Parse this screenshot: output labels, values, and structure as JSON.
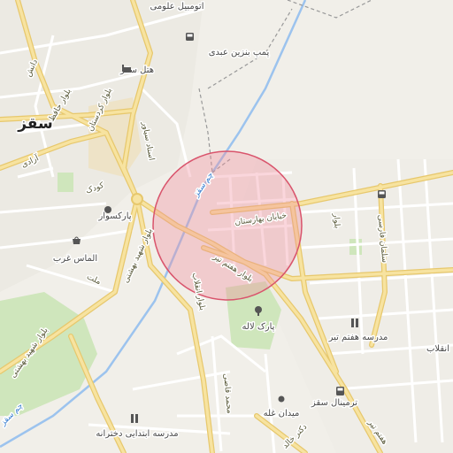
{
  "map": {
    "city": "سقز",
    "highlight": {
      "fill": "#f08a9a",
      "stroke": "#d9546c"
    },
    "labels": {
      "automobile": "اتومبیل علومی",
      "gas_station": "پمپ بنزین عبدی",
      "hotel": "هتل سقز",
      "boulevard_kurdistan": "بلوار کردستان",
      "boulevard_hafez": "بلوار حافظ",
      "ostad_seyavar": "استاد سیاور",
      "azadi": "آزادی",
      "koodak": "کودک",
      "parksvar": "پارکسوار",
      "almas_gharb": "الماس غرب",
      "mellat": "ملت",
      "shahid_beheshti": "بلوار شهید بهشتی",
      "shahid_beheshti_2": "بلوار شهید بهشتی",
      "khiaban_baharestan": "خیابان بهارستان",
      "boulevard_haftom_tir": "بلوار هفتم تیر",
      "boulevard_enghelab": "بلوار انقلاب",
      "boulevard_small": "بلوار",
      "salman_farsi": "سلمان فارسی",
      "enghelab": "انقلاب",
      "park_laleh": "پارک لاله",
      "madreseh_haftom_tir": "مدرسه هفتم تیر",
      "mohammad_ghazi": "محمد قاضی",
      "meydan_ghaleh": "میدان غله",
      "terminal": "ترمینال سقز",
      "haftom_tir": "هفتم تیر",
      "dr_khaled": "دکتر خالد",
      "madreseh_ebtedaei": "مدرسه ابتدایی دخترانه",
      "river": "چم سقز",
      "river_2": "چم سقز",
      "ostad": "دانش"
    }
  }
}
